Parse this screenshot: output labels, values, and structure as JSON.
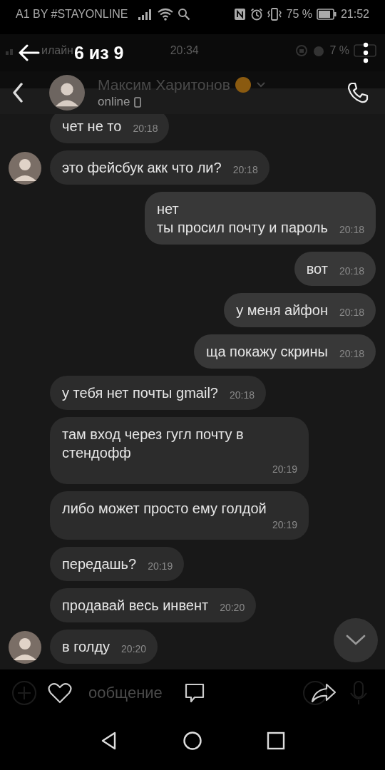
{
  "status_bar": {
    "carrier": "A1 BY #STAYONLINE",
    "battery": "75 %",
    "time": "21:52"
  },
  "viewer": {
    "counter": "6 из 9"
  },
  "inner_status": {
    "carrier": "илайн",
    "time": "20:34",
    "battery": "7 %"
  },
  "chat_header": {
    "name": "Максим Харитонов",
    "presence": "online"
  },
  "messages": [
    {
      "kind": "incoming",
      "avatar": false,
      "text": "чет не то",
      "time": "20:18"
    },
    {
      "kind": "incoming",
      "avatar": true,
      "text": "это фейсбук акк что ли?",
      "time": "20:18"
    },
    {
      "kind": "outgoing",
      "avatar": false,
      "text": "нет\nты просил почту и пароль",
      "time": "20:18"
    },
    {
      "kind": "outgoing",
      "avatar": false,
      "text": "вот",
      "time": "20:18"
    },
    {
      "kind": "outgoing",
      "avatar": false,
      "text": "у меня айфон",
      "time": "20:18"
    },
    {
      "kind": "outgoing",
      "avatar": false,
      "text": "ща покажу скрины",
      "time": "20:18"
    },
    {
      "kind": "incoming",
      "avatar": false,
      "text": "у тебя нет почты gmail?",
      "time": "20:18"
    },
    {
      "kind": "incoming",
      "avatar": false,
      "text": "там вход через гугл почту в стендофф",
      "time": "20:19"
    },
    {
      "kind": "incoming",
      "avatar": false,
      "text": "либо может просто ему голдой",
      "time": "20:19"
    },
    {
      "kind": "incoming",
      "avatar": false,
      "text": "передашь?",
      "time": "20:19"
    },
    {
      "kind": "incoming",
      "avatar": false,
      "text": "продавай весь инвент",
      "time": "20:20"
    },
    {
      "kind": "incoming",
      "avatar": true,
      "text": "в голду",
      "time": "20:20"
    }
  ],
  "composer": {
    "placeholder": "ообщение"
  }
}
